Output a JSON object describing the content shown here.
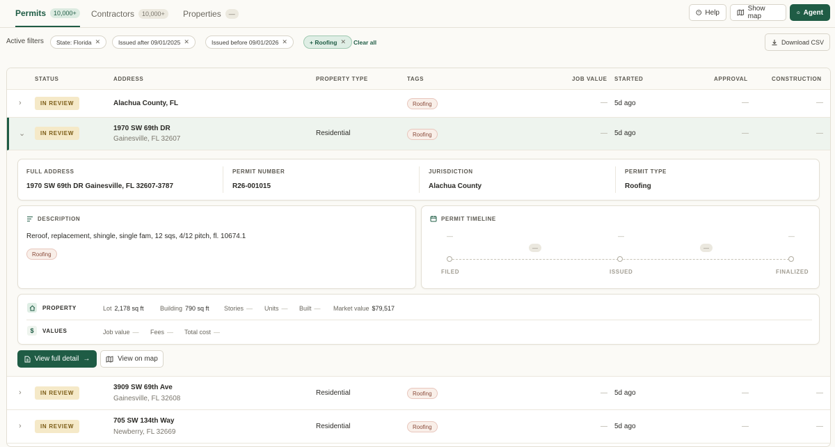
{
  "nav": {
    "tabs": [
      {
        "label": "Permits",
        "count": "10,000+"
      },
      {
        "label": "Contractors",
        "count": "10,000+"
      },
      {
        "label": "Properties",
        "count": "—"
      }
    ],
    "help": "Help",
    "show_map": "Show map",
    "agent": "Agent"
  },
  "filters": {
    "label": "Active filters",
    "chips": [
      "State: Florida",
      "Issued after 09/01/2025",
      "Issued before 09/01/2026",
      "+ Roofing"
    ],
    "clear_all": "Clear all",
    "download": "Download CSV"
  },
  "columns": [
    "STATUS",
    "ADDRESS",
    "PROPERTY TYPE",
    "TAGS",
    "JOB VALUE",
    "STARTED",
    "APPROVAL",
    "CONSTRUCTION"
  ],
  "rows": [
    {
      "status": "IN REVIEW",
      "address1": "Alachua County, FL",
      "address2": "",
      "property_type": "",
      "tag": "Roofing",
      "job_value": "—",
      "started": "5d ago",
      "approval": "—",
      "construction": "—"
    },
    {
      "status": "IN REVIEW",
      "address1": "1970 SW 69th DR",
      "address2": "Gainesville, FL 32607",
      "property_type": "Residential",
      "tag": "Roofing",
      "job_value": "—",
      "started": "5d ago",
      "approval": "—",
      "construction": "—"
    },
    {
      "status": "IN REVIEW",
      "address1": "3909 SW 69th Ave",
      "address2": "Gainesville, FL 32608",
      "property_type": "Residential",
      "tag": "Roofing",
      "job_value": "—",
      "started": "5d ago",
      "approval": "—",
      "construction": "—"
    },
    {
      "status": "IN REVIEW",
      "address1": "705 SW 134th Way",
      "address2": "Newberry, FL 32669",
      "property_type": "Residential",
      "tag": "Roofing",
      "job_value": "—",
      "started": "5d ago",
      "approval": "—",
      "construction": "—"
    }
  ],
  "detail": {
    "full_address_label": "FULL ADDRESS",
    "full_address": "1970 SW 69th DR Gainesville, FL 32607-3787",
    "permit_number_label": "PERMIT NUMBER",
    "permit_number": "R26-001015",
    "jurisdiction_label": "JURISDICTION",
    "jurisdiction": "Alachua County",
    "permit_type_label": "PERMIT TYPE",
    "permit_type": "Roofing",
    "description_label": "DESCRIPTION",
    "description": "Reroof, replacement, shingle, single fam, 12 sqs, 4/12 pitch, fl. 10674.1",
    "description_tag": "Roofing",
    "timeline_label": "PERMIT TIMELINE",
    "timeline": {
      "steps": [
        "FILED",
        "ISSUED",
        "FINALIZED"
      ],
      "dates": [
        "—",
        "—",
        "—"
      ],
      "durations": [
        "—",
        "—"
      ]
    },
    "property_label": "PROPERTY",
    "property": [
      {
        "k": "Lot",
        "v": "2,178 sq ft"
      },
      {
        "k": "Building",
        "v": "790 sq ft"
      },
      {
        "k": "Stories",
        "v": "—"
      },
      {
        "k": "Units",
        "v": "—"
      },
      {
        "k": "Built",
        "v": "—"
      },
      {
        "k": "Market value",
        "v": "$79,517"
      }
    ],
    "values_label": "VALUES",
    "values": [
      {
        "k": "Job value",
        "v": "—"
      },
      {
        "k": "Fees",
        "v": "—"
      },
      {
        "k": "Total cost",
        "v": "—"
      }
    ],
    "view_full_detail": "View full detail",
    "view_on_map": "View on map"
  },
  "icons": {
    "help": "help-circle-icon",
    "map": "map-icon",
    "agent": "agent-icon",
    "download": "download-icon",
    "description": "lines-icon",
    "timeline": "calendar-icon",
    "property": "home-icon",
    "values": "dollar-icon"
  },
  "colors": {
    "accent": "#1f5c45",
    "status_bg": "#f5e9c8",
    "tag_bg": "#f9efe9"
  }
}
